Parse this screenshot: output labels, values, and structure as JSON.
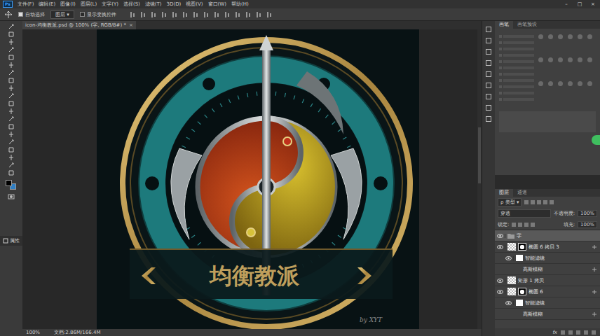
{
  "app": {
    "logo": "Ps",
    "menu": [
      "文件(F)",
      "编辑(E)",
      "图像(I)",
      "图层(L)",
      "文字(Y)",
      "选择(S)",
      "滤镜(T)",
      "3D(D)",
      "视图(V)",
      "窗口(W)",
      "帮助(H)"
    ],
    "window_controls": [
      "–",
      "□",
      "×"
    ]
  },
  "options": {
    "auto_select": {
      "label": "自动选择",
      "checked": true
    },
    "target": "图层",
    "transform": {
      "label": "显示变换控件",
      "checked": false
    }
  },
  "document_tab": {
    "title": "icon-均衡教派.psd @ 100% (字, RGB/8#) *",
    "close": "×"
  },
  "artwork": {
    "title": "均衡教派",
    "signature": "by XYT"
  },
  "status_bar": {
    "zoom": "100%",
    "doc": "文档:2.86M/166.4M"
  },
  "left_panel": {
    "label": "属性"
  },
  "brush_panel": {
    "tabs": [
      {
        "label": "画笔",
        "selected": true
      },
      {
        "label": "画笔预设",
        "selected": false
      }
    ]
  },
  "layers_panel": {
    "tabs": [
      {
        "label": "图层",
        "selected": true
      },
      {
        "label": "通道",
        "selected": false
      }
    ],
    "filter": "ρ 类型",
    "blend": "穿透",
    "opacity_label": "不透明度:",
    "opacity": "100%",
    "lock_label": "锁定:",
    "fill_label": "填充:",
    "fill": "100%",
    "layers": [
      {
        "name": "字",
        "kind": "group",
        "visible": true,
        "selected": true
      },
      {
        "name": "椭圆 6 拷贝 3",
        "kind": "layer",
        "visible": true,
        "selected": false
      },
      {
        "name": "智能滤镜",
        "kind": "filter",
        "visible": true,
        "selected": false
      },
      {
        "name": "高斯模糊",
        "kind": "effect",
        "visible": false,
        "selected": false
      },
      {
        "name": "矩形 1 拷贝",
        "kind": "plain",
        "visible": true,
        "selected": false
      },
      {
        "name": "椭圆 6",
        "kind": "layer",
        "visible": true,
        "selected": false
      },
      {
        "name": "智能滤镜",
        "kind": "filter",
        "visible": true,
        "selected": false
      },
      {
        "name": "高斯模糊",
        "kind": "effect",
        "visible": false,
        "selected": false
      }
    ],
    "footer": "fx"
  }
}
